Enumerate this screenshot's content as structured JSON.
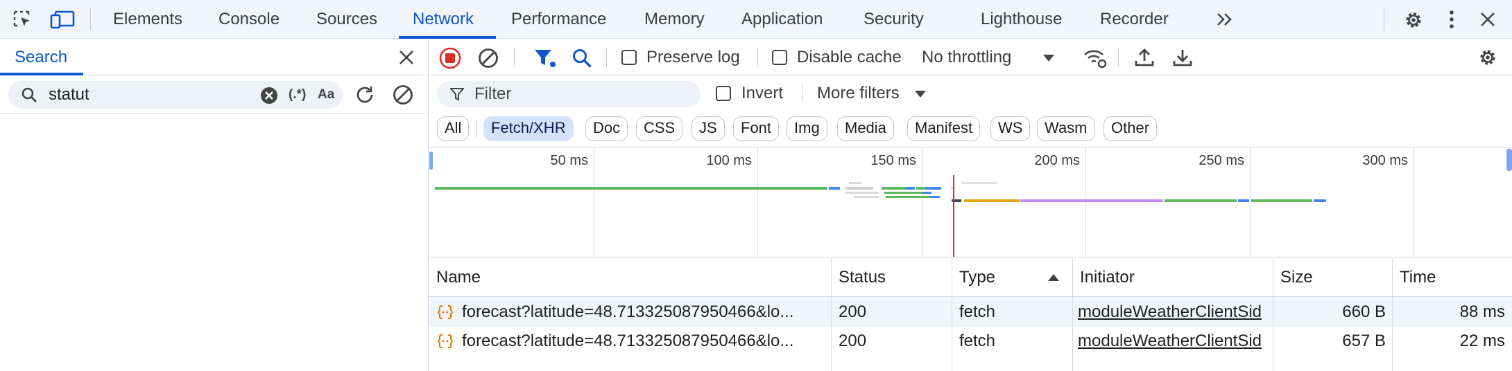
{
  "top_tabs": [
    "Elements",
    "Console",
    "Sources",
    "Network",
    "Performance",
    "Memory",
    "Application",
    "Security",
    "Lighthouse",
    "Recorder"
  ],
  "active_tab": "Network",
  "search_panel": {
    "tab_label": "Search",
    "query": "statut",
    "regex_label": "(.*)",
    "case_label": "Aa"
  },
  "toolbar": {
    "preserve_log": "Preserve log",
    "disable_cache": "Disable cache",
    "throttling": "No throttling"
  },
  "filter": {
    "placeholder": "Filter",
    "invert": "Invert",
    "more_filters": "More filters"
  },
  "type_filters": [
    "All",
    "Fetch/XHR",
    "Doc",
    "CSS",
    "JS",
    "Font",
    "Img",
    "Media",
    "Manifest",
    "WS",
    "Wasm",
    "Other"
  ],
  "active_type_filter": "Fetch/XHR",
  "overview": {
    "tick_labels": [
      "50 ms",
      "100 ms",
      "150 ms",
      "200 ms",
      "250 ms",
      "300 ms"
    ]
  },
  "table": {
    "columns": [
      "Name",
      "Status",
      "Type",
      "Initiator",
      "Size",
      "Time"
    ],
    "sorted_column": "Type",
    "rows": [
      {
        "name": "forecast?latitude=48.713325087950466&lo...",
        "status": "200",
        "type": "fetch",
        "initiator": "moduleWeatherClientSid",
        "size": "660 B",
        "time": "88 ms"
      },
      {
        "name": "forecast?latitude=48.713325087950466&lo...",
        "status": "200",
        "type": "fetch",
        "initiator": "moduleWeatherClientSid",
        "size": "657 B",
        "time": "22 ms"
      }
    ]
  },
  "colors": {
    "accent": "#0b57d0",
    "record_red": "#d93025",
    "bar_green": "#5cb85c",
    "bar_blue": "#4285f4",
    "bar_orange": "#e8a317",
    "bar_purple": "#c58af9"
  }
}
